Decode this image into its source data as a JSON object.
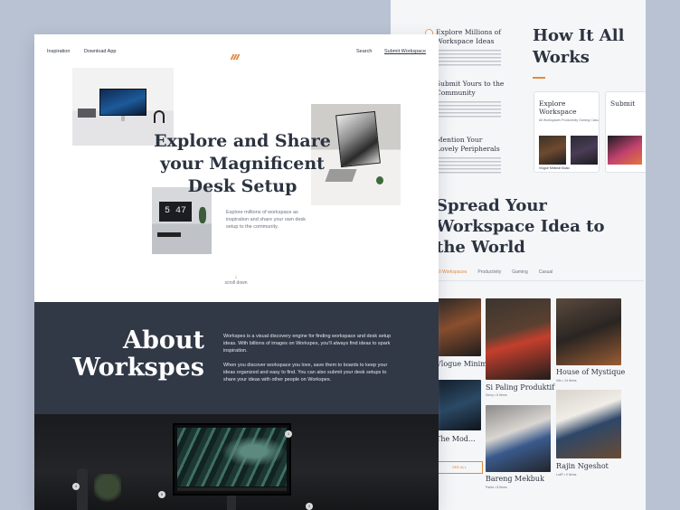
{
  "nav": {
    "inspiration": "Inspiration",
    "download": "Download App",
    "search": "Search",
    "submit": "Submit Workspace"
  },
  "hero": {
    "title": "Explore and Share your Magnificent Desk Setup",
    "description": "Explore millions of workspace as inspiration and share your own desk setup to the community.",
    "scroll": "scroll down",
    "clock": "5 47"
  },
  "about": {
    "title": "About Workspes",
    "p1": "Workspes is a visual discovery engine for finding workspace and desk setup ideas. With billions of images on Workspes, you'll always find ideas to spark inspiration.",
    "p2": "When you discover workspace you love, save them to boards to keep your ideas organized and easy to find. You can also submit your desk setups to share your ideas with other people on Workspes."
  },
  "hotspots": [
    "1",
    "6",
    "4",
    "2"
  ],
  "how": {
    "title": "How It All Works",
    "steps": [
      {
        "title": "Explore Millions of Workspace Ideas"
      },
      {
        "title": "Submit Yours to the Community"
      },
      {
        "title": "Mention Your Lovely Peripherals"
      }
    ],
    "card1_title": "Explore Workspace",
    "card1_tabs": "All Workspaces   Productivity   Gaming   Casual",
    "card1_caption": "Vlogue Minimal Music",
    "card2_title": "Submit"
  },
  "spread": {
    "title": "Spread Your Workspace Idea to the World",
    "tabs": [
      "All Workspaces",
      "Productivity",
      "Gaming",
      "Casual"
    ],
    "see_all": "SEE ALL"
  },
  "gallery": [
    {
      "title": "Vlogue Minimal Music",
      "meta": ""
    },
    {
      "title": "Si Paling Produktif",
      "meta": "Dinny • 6 Items"
    },
    {
      "title": "House of Mystique",
      "meta": "Vito • 14 Items"
    },
    {
      "title": "The Mode of the Mountain",
      "meta": ""
    },
    {
      "title": "Bareng Mekbuk",
      "meta": "Panto • 8 Items"
    },
    {
      "title": "Rajin Ngeshot",
      "meta": "LuliP • 9 Items"
    }
  ],
  "colors": {
    "accent": "#e2893f",
    "dark": "#313846",
    "text": "#2c3340",
    "background": "#b8c2d2"
  }
}
